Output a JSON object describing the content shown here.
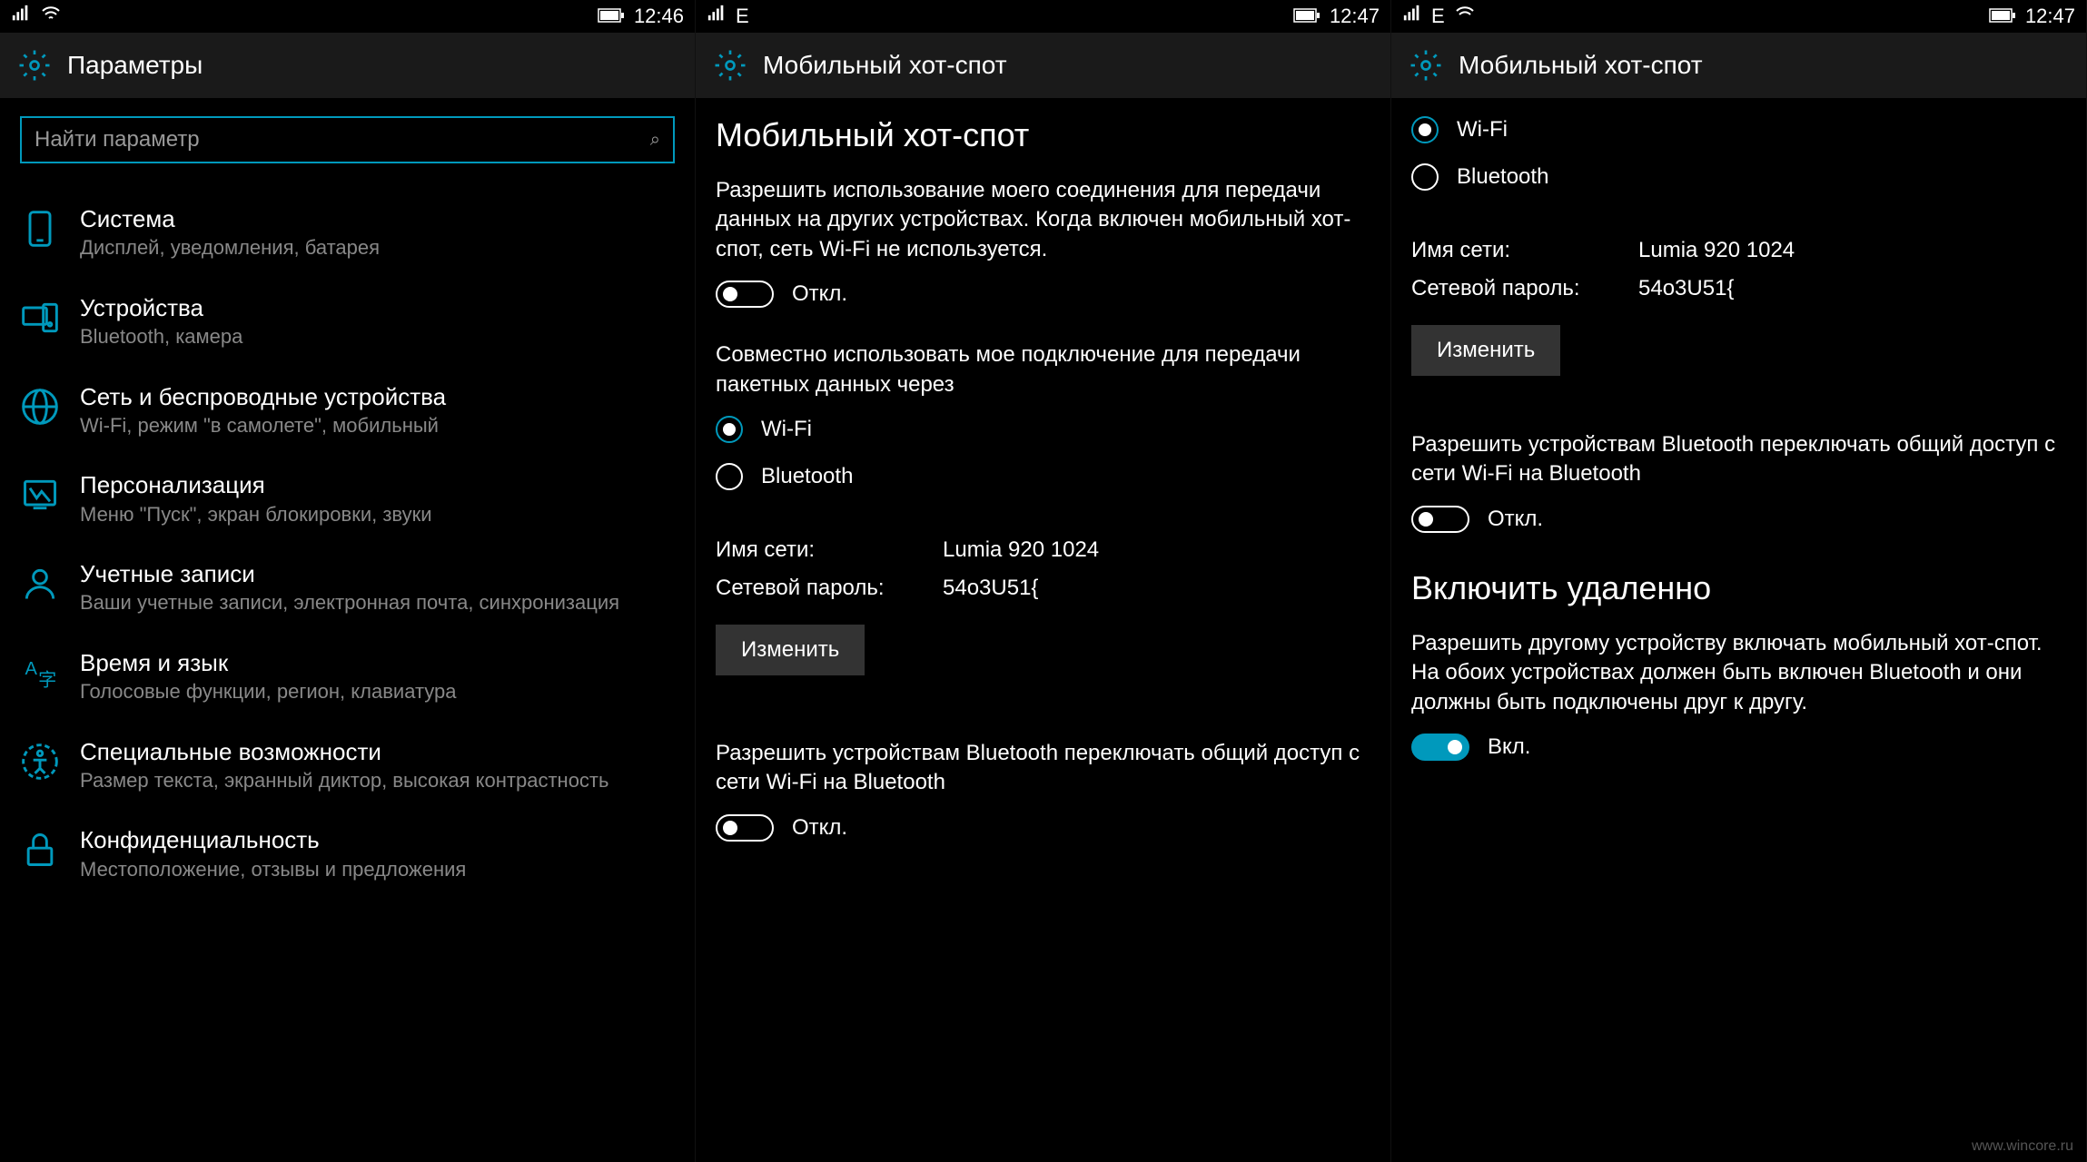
{
  "panel1": {
    "status": {
      "time": "12:46"
    },
    "header": {
      "title": "Параметры"
    },
    "search": {
      "placeholder": "Найти параметр"
    },
    "items": [
      {
        "title": "Система",
        "sub": "Дисплей, уведомления, батарея"
      },
      {
        "title": "Устройства",
        "sub": "Bluetooth, камера"
      },
      {
        "title": "Сеть и беспроводные устройства",
        "sub": "Wi-Fi, режим \"в самолете\", мобильный"
      },
      {
        "title": "Персонализация",
        "sub": "Меню \"Пуск\", экран блокировки, звуки"
      },
      {
        "title": "Учетные записи",
        "sub": "Ваши учетные записи, электронная почта, синхронизация"
      },
      {
        "title": "Время и язык",
        "sub": "Голосовые функции, регион, клавиатура"
      },
      {
        "title": "Специальные возможности",
        "sub": "Размер текста, экранный диктор, высокая контрастность"
      },
      {
        "title": "Конфиденциальность",
        "sub": "Местоположение, отзывы и предложения"
      }
    ]
  },
  "panel2": {
    "status": {
      "network": "E",
      "time": "12:47"
    },
    "header": {
      "title": "Мобильный хот-спот"
    },
    "section_title": "Мобильный хот-спот",
    "desc": "Разрешить использование моего соединения для передачи данных на других устройствах. Когда включен мобильный хот-спот, сеть Wi-Fi не используется.",
    "toggle1": {
      "state": "off",
      "label": "Откл."
    },
    "share_label": "Совместно использовать мое подключение для передачи пакетных данных через",
    "radio_wifi": "Wi-Fi",
    "radio_bt": "Bluetooth",
    "net_name_label": "Имя сети:",
    "net_name_value": "Lumia 920 1024",
    "net_pass_label": "Сетевой пароль:",
    "net_pass_value": "54o3U51{",
    "edit_btn": "Изменить",
    "bt_switch_label": "Разрешить устройствам Bluetooth переключать общий доступ с сети Wi-Fi на Bluetooth",
    "toggle2": {
      "state": "off",
      "label": "Откл."
    }
  },
  "panel3": {
    "status": {
      "network": "E",
      "time": "12:47"
    },
    "header": {
      "title": "Мобильный хот-спот"
    },
    "radio_wifi": "Wi-Fi",
    "radio_bt": "Bluetooth",
    "net_name_label": "Имя сети:",
    "net_name_value": "Lumia 920 1024",
    "net_pass_label": "Сетевой пароль:",
    "net_pass_value": "54o3U51{",
    "edit_btn": "Изменить",
    "bt_switch_label": "Разрешить устройствам Bluetooth переключать общий доступ с сети Wi-Fi на Bluetooth",
    "toggle_bt": {
      "state": "off",
      "label": "Откл."
    },
    "remote_title": "Включить удаленно",
    "remote_desc": "Разрешить другому устройству включать мобильный хот-спот. На обоих устройствах должен быть включен Bluetooth и они должны быть подключены друг к другу.",
    "toggle_remote": {
      "state": "on",
      "label": "Вкл."
    },
    "watermark": "www.wincore.ru"
  }
}
